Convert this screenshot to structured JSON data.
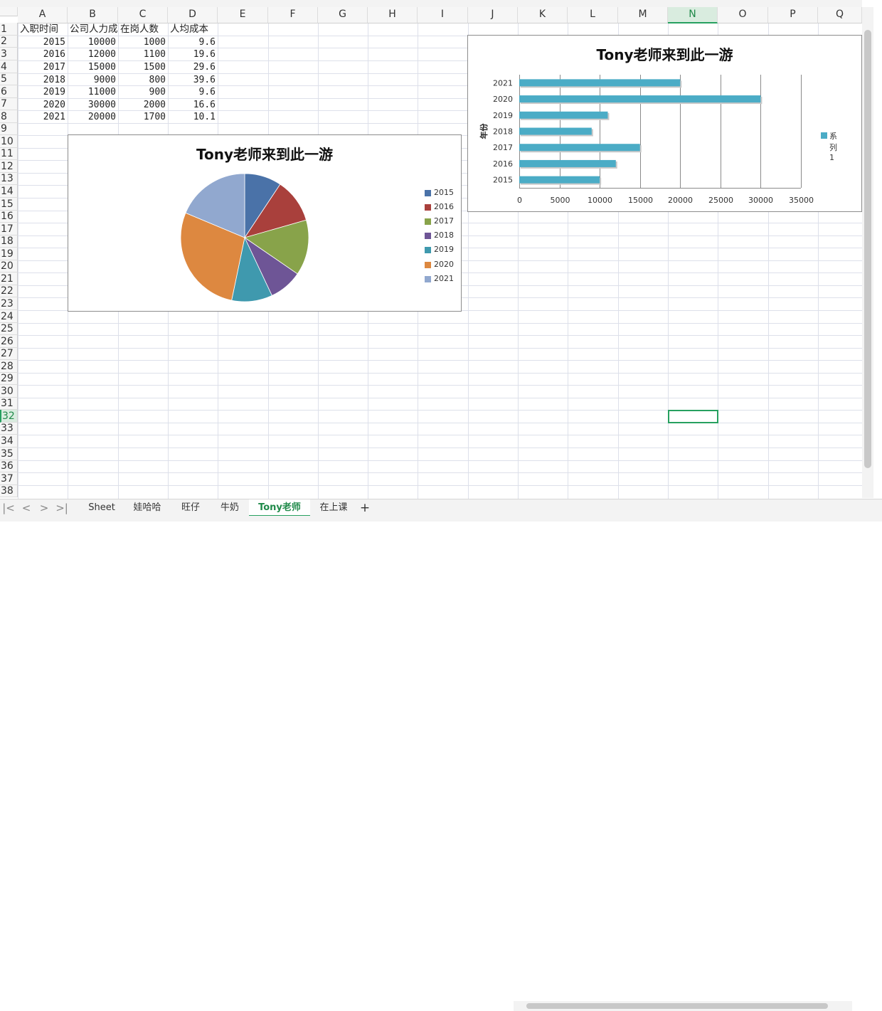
{
  "columns": [
    "A",
    "B",
    "C",
    "D",
    "E",
    "F",
    "G",
    "H",
    "I",
    "J",
    "K",
    "L",
    "M",
    "N",
    "O",
    "P",
    "Q"
  ],
  "selected_column": "N",
  "selected_row": 32,
  "row_count": 38,
  "sheet_rows": [
    [
      "入职时间",
      "公司人力成",
      "在岗人数",
      "人均成本"
    ],
    [
      "2015",
      "10000",
      "1000",
      "9.6"
    ],
    [
      "2016",
      "12000",
      "1100",
      "19.6"
    ],
    [
      "2017",
      "15000",
      "1500",
      "29.6"
    ],
    [
      "2018",
      "9000",
      "800",
      "39.6"
    ],
    [
      "2019",
      "11000",
      "900",
      "9.6"
    ],
    [
      "2020",
      "30000",
      "2000",
      "16.6"
    ],
    [
      "2021",
      "20000",
      "1700",
      "10.1"
    ]
  ],
  "chart_data": [
    {
      "type": "pie",
      "title": "Tony老师来到此一游",
      "categories": [
        "2015",
        "2016",
        "2017",
        "2018",
        "2019",
        "2020",
        "2021"
      ],
      "values": [
        10000,
        12000,
        15000,
        9000,
        11000,
        30000,
        20000
      ],
      "colors": [
        "#4a72a8",
        "#a9403c",
        "#88a34a",
        "#6e5596",
        "#3f99ae",
        "#dd8840",
        "#91a8cf"
      ],
      "legend": "right"
    },
    {
      "type": "bar",
      "orientation": "horizontal",
      "title": "Tony老师来到此一游",
      "categories": [
        "2015",
        "2016",
        "2017",
        "2018",
        "2019",
        "2020",
        "2021"
      ],
      "series": [
        {
          "name": "系列1",
          "values": [
            10000,
            12000,
            15000,
            9000,
            11000,
            30000,
            20000
          ]
        }
      ],
      "color": "#4bacc6",
      "ylabel": "年份",
      "xlim": [
        0,
        35000
      ],
      "xticks": [
        "0",
        "5000",
        "10000",
        "15000",
        "20000",
        "25000",
        "30000",
        "35000"
      ],
      "grid": true,
      "legend": "right"
    }
  ],
  "sheet_tabs": [
    "Sheet",
    "娃哈哈",
    "旺仔",
    "牛奶",
    "Tony老师",
    "在上课"
  ],
  "active_tab": "Tony老师",
  "add_tab_label": "+",
  "nav_buttons": [
    "|<",
    "<",
    ">",
    ">|"
  ]
}
